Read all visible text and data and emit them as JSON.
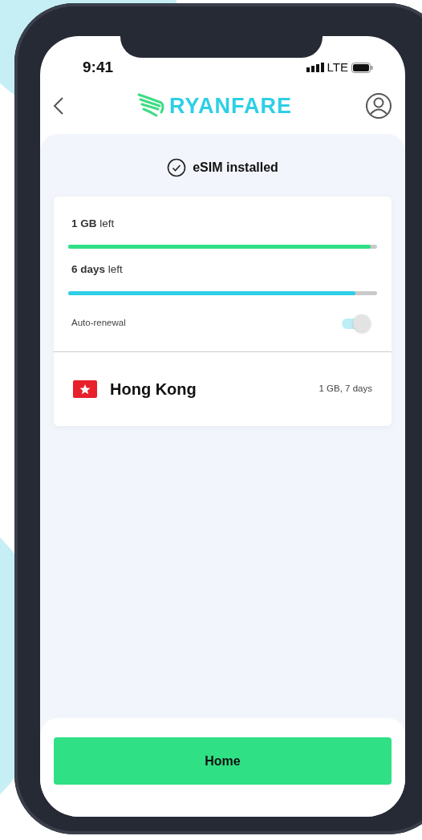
{
  "status_bar": {
    "time": "9:41",
    "network": "LTE"
  },
  "header": {
    "logo_text": "RYANFARE"
  },
  "status": {
    "text": "eSIM installed"
  },
  "usage": [
    {
      "text": "**1 GB** left",
      "level": 0.98,
      "color": "#2fe085"
    },
    {
      "text": "**6 days** left",
      "level": 0.93,
      "color": "#2ecfe6"
    }
  ],
  "auto_renewal": {
    "label": "Auto-renewal",
    "on": true
  },
  "plan": {
    "country": "Hong Kong",
    "details": "1 GB, 7 days"
  },
  "primary_button": {
    "label": "Home"
  }
}
